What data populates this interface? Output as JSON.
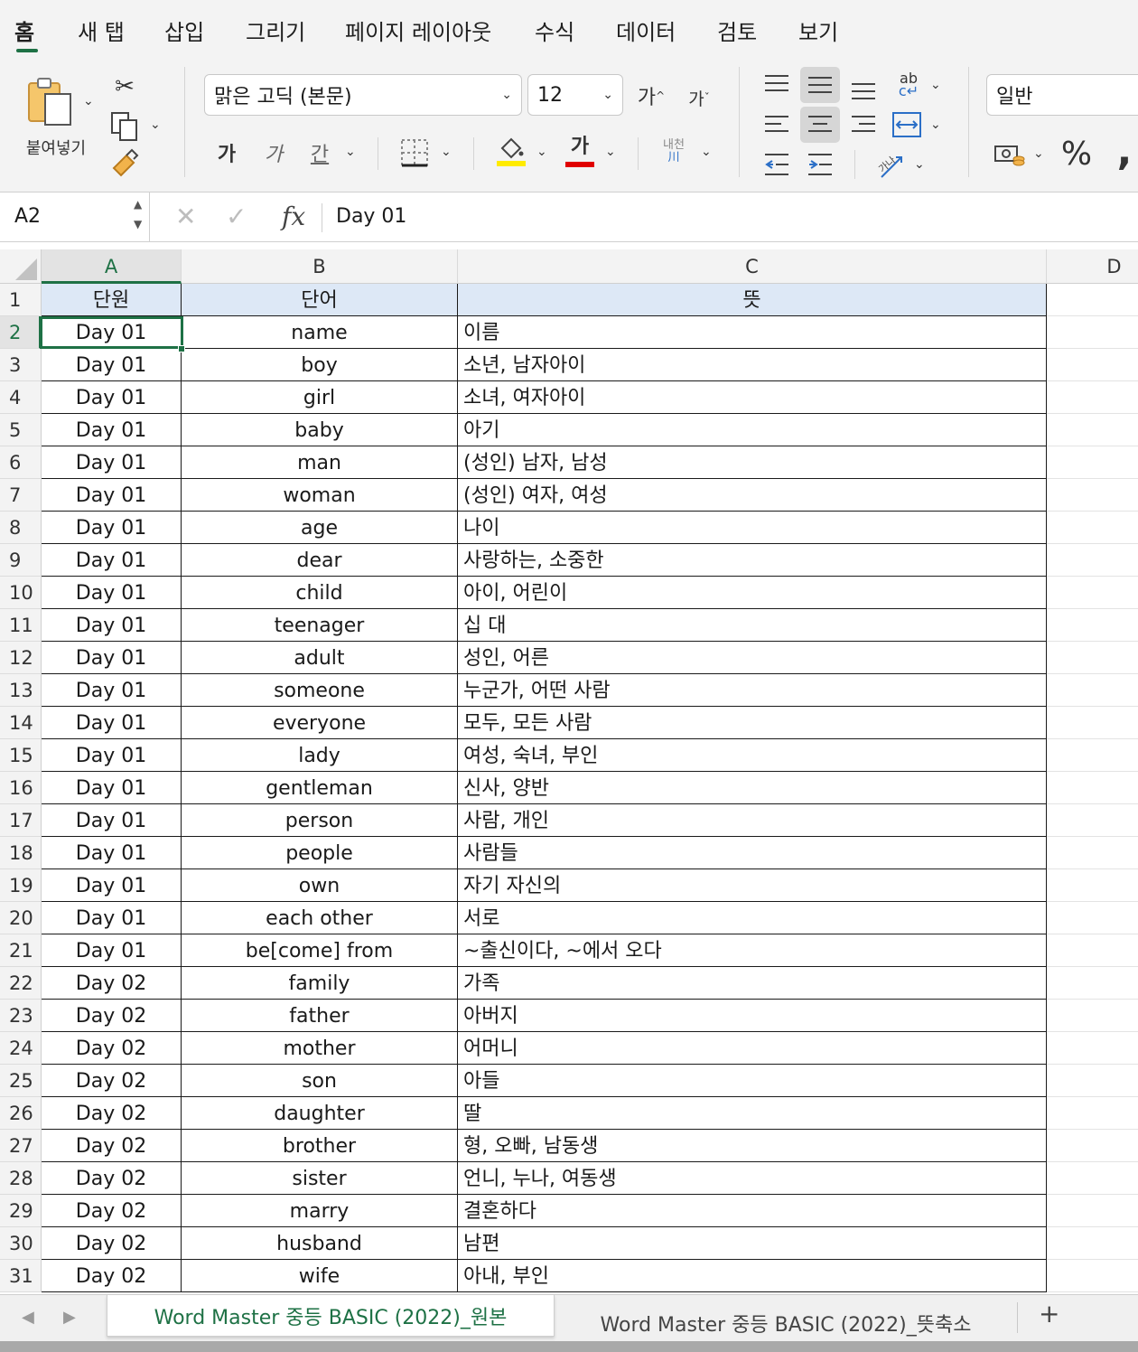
{
  "ribbon_tabs": [
    "홈",
    "새 탭",
    "삽입",
    "그리기",
    "페이지 레이아웃",
    "수식",
    "데이터",
    "검토",
    "보기"
  ],
  "ribbon": {
    "paste_label": "붙여넣기",
    "font_name": "맑은 고딕 (본문)",
    "font_size": "12",
    "grow_font": "가",
    "shrink_font": "가",
    "bold": "가",
    "italic": "가",
    "underline": "간",
    "font_color_glyph": "가",
    "phonetic_label": "내천",
    "number_format": "일반",
    "percent": "%",
    "comma": ",",
    "highlight_color": "#ffeb00",
    "font_color": "#e00000"
  },
  "formula_bar": {
    "name_box": "A2",
    "formula": "Day 01"
  },
  "columns": [
    "A",
    "B",
    "C",
    "D"
  ],
  "active_cell": "A2",
  "header_row": {
    "row": "1",
    "a": "단원",
    "b": "단어",
    "c": "뜻"
  },
  "rows": [
    {
      "row": "2",
      "a": "Day 01",
      "b": "name",
      "c": "이름"
    },
    {
      "row": "3",
      "a": "Day 01",
      "b": "boy",
      "c": "소년, 남자아이"
    },
    {
      "row": "4",
      "a": "Day 01",
      "b": "girl",
      "c": "소녀, 여자아이"
    },
    {
      "row": "5",
      "a": "Day 01",
      "b": "baby",
      "c": "아기"
    },
    {
      "row": "6",
      "a": "Day 01",
      "b": "man",
      "c": "(성인) 남자, 남성"
    },
    {
      "row": "7",
      "a": "Day 01",
      "b": "woman",
      "c": "(성인) 여자, 여성"
    },
    {
      "row": "8",
      "a": "Day 01",
      "b": "age",
      "c": "나이"
    },
    {
      "row": "9",
      "a": "Day 01",
      "b": "dear",
      "c": "사랑하는, 소중한"
    },
    {
      "row": "10",
      "a": "Day 01",
      "b": "child",
      "c": "아이, 어린이"
    },
    {
      "row": "11",
      "a": "Day 01",
      "b": "teenager",
      "c": "십 대"
    },
    {
      "row": "12",
      "a": "Day 01",
      "b": "adult",
      "c": "성인, 어른"
    },
    {
      "row": "13",
      "a": "Day 01",
      "b": "someone",
      "c": "누군가, 어떤 사람"
    },
    {
      "row": "14",
      "a": "Day 01",
      "b": "everyone",
      "c": "모두, 모든 사람"
    },
    {
      "row": "15",
      "a": "Day 01",
      "b": "lady",
      "c": "여성, 숙녀, 부인"
    },
    {
      "row": "16",
      "a": "Day 01",
      "b": "gentleman",
      "c": "신사, 양반"
    },
    {
      "row": "17",
      "a": "Day 01",
      "b": "person",
      "c": "사람, 개인"
    },
    {
      "row": "18",
      "a": "Day 01",
      "b": "people",
      "c": "사람들"
    },
    {
      "row": "19",
      "a": "Day 01",
      "b": "own",
      "c": "자기 자신의"
    },
    {
      "row": "20",
      "a": "Day 01",
      "b": "each other",
      "c": "서로"
    },
    {
      "row": "21",
      "a": "Day 01",
      "b": "be[come] from",
      "c": "~출신이다, ~에서 오다"
    },
    {
      "row": "22",
      "a": "Day 02",
      "b": "family",
      "c": "가족"
    },
    {
      "row": "23",
      "a": "Day 02",
      "b": "father",
      "c": "아버지"
    },
    {
      "row": "24",
      "a": "Day 02",
      "b": "mother",
      "c": "어머니"
    },
    {
      "row": "25",
      "a": "Day 02",
      "b": "son",
      "c": "아들"
    },
    {
      "row": "26",
      "a": "Day 02",
      "b": "daughter",
      "c": "딸"
    },
    {
      "row": "27",
      "a": "Day 02",
      "b": "brother",
      "c": "형, 오빠, 남동생"
    },
    {
      "row": "28",
      "a": "Day 02",
      "b": "sister",
      "c": "언니, 누나, 여동생"
    },
    {
      "row": "29",
      "a": "Day 02",
      "b": "marry",
      "c": "결혼하다"
    },
    {
      "row": "30",
      "a": "Day 02",
      "b": "husband",
      "c": "남편"
    },
    {
      "row": "31",
      "a": "Day 02",
      "b": "wife",
      "c": "아내, 부인"
    }
  ],
  "sheet_tabs": [
    {
      "label": "Word Master 중등 BASIC (2022)_원본",
      "active": true
    },
    {
      "label": "Word Master 중등 BASIC (2022)_뜻축소",
      "active": false
    }
  ],
  "sheet_add_label": "+",
  "colors": {
    "accent": "#1e7145",
    "header_fill": "#dde8f6"
  }
}
